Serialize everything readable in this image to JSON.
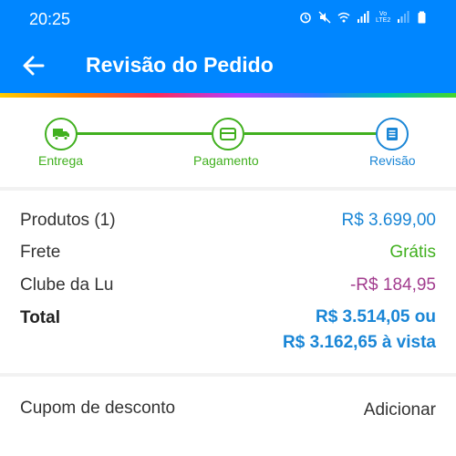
{
  "status_bar": {
    "time": "20:25",
    "network_label": "Vo LTE2"
  },
  "header": {
    "title": "Revisão do Pedido"
  },
  "steps": [
    {
      "label": "Entrega",
      "state": "done",
      "icon": "truck-icon"
    },
    {
      "label": "Pagamento",
      "state": "done",
      "icon": "card-icon"
    },
    {
      "label": "Revisão",
      "state": "current",
      "icon": "receipt-icon"
    }
  ],
  "summary": {
    "products_label": "Produtos (1)",
    "products_value": "R$ 3.699,00",
    "shipping_label": "Frete",
    "shipping_value": "Grátis",
    "club_label": "Clube da Lu",
    "club_value": "-R$ 184,95",
    "total_label": "Total",
    "total_value_line1": "R$ 3.514,05 ou",
    "total_value_line2": "R$ 3.162,65 à vista"
  },
  "coupon": {
    "label": "Cupom de desconto",
    "action": "Adicionar"
  },
  "colors": {
    "primary_blue": "#0086ff",
    "step_green": "#41b01f",
    "price_blue": "#1a86d6",
    "discount_purple": "#a23c8e"
  }
}
